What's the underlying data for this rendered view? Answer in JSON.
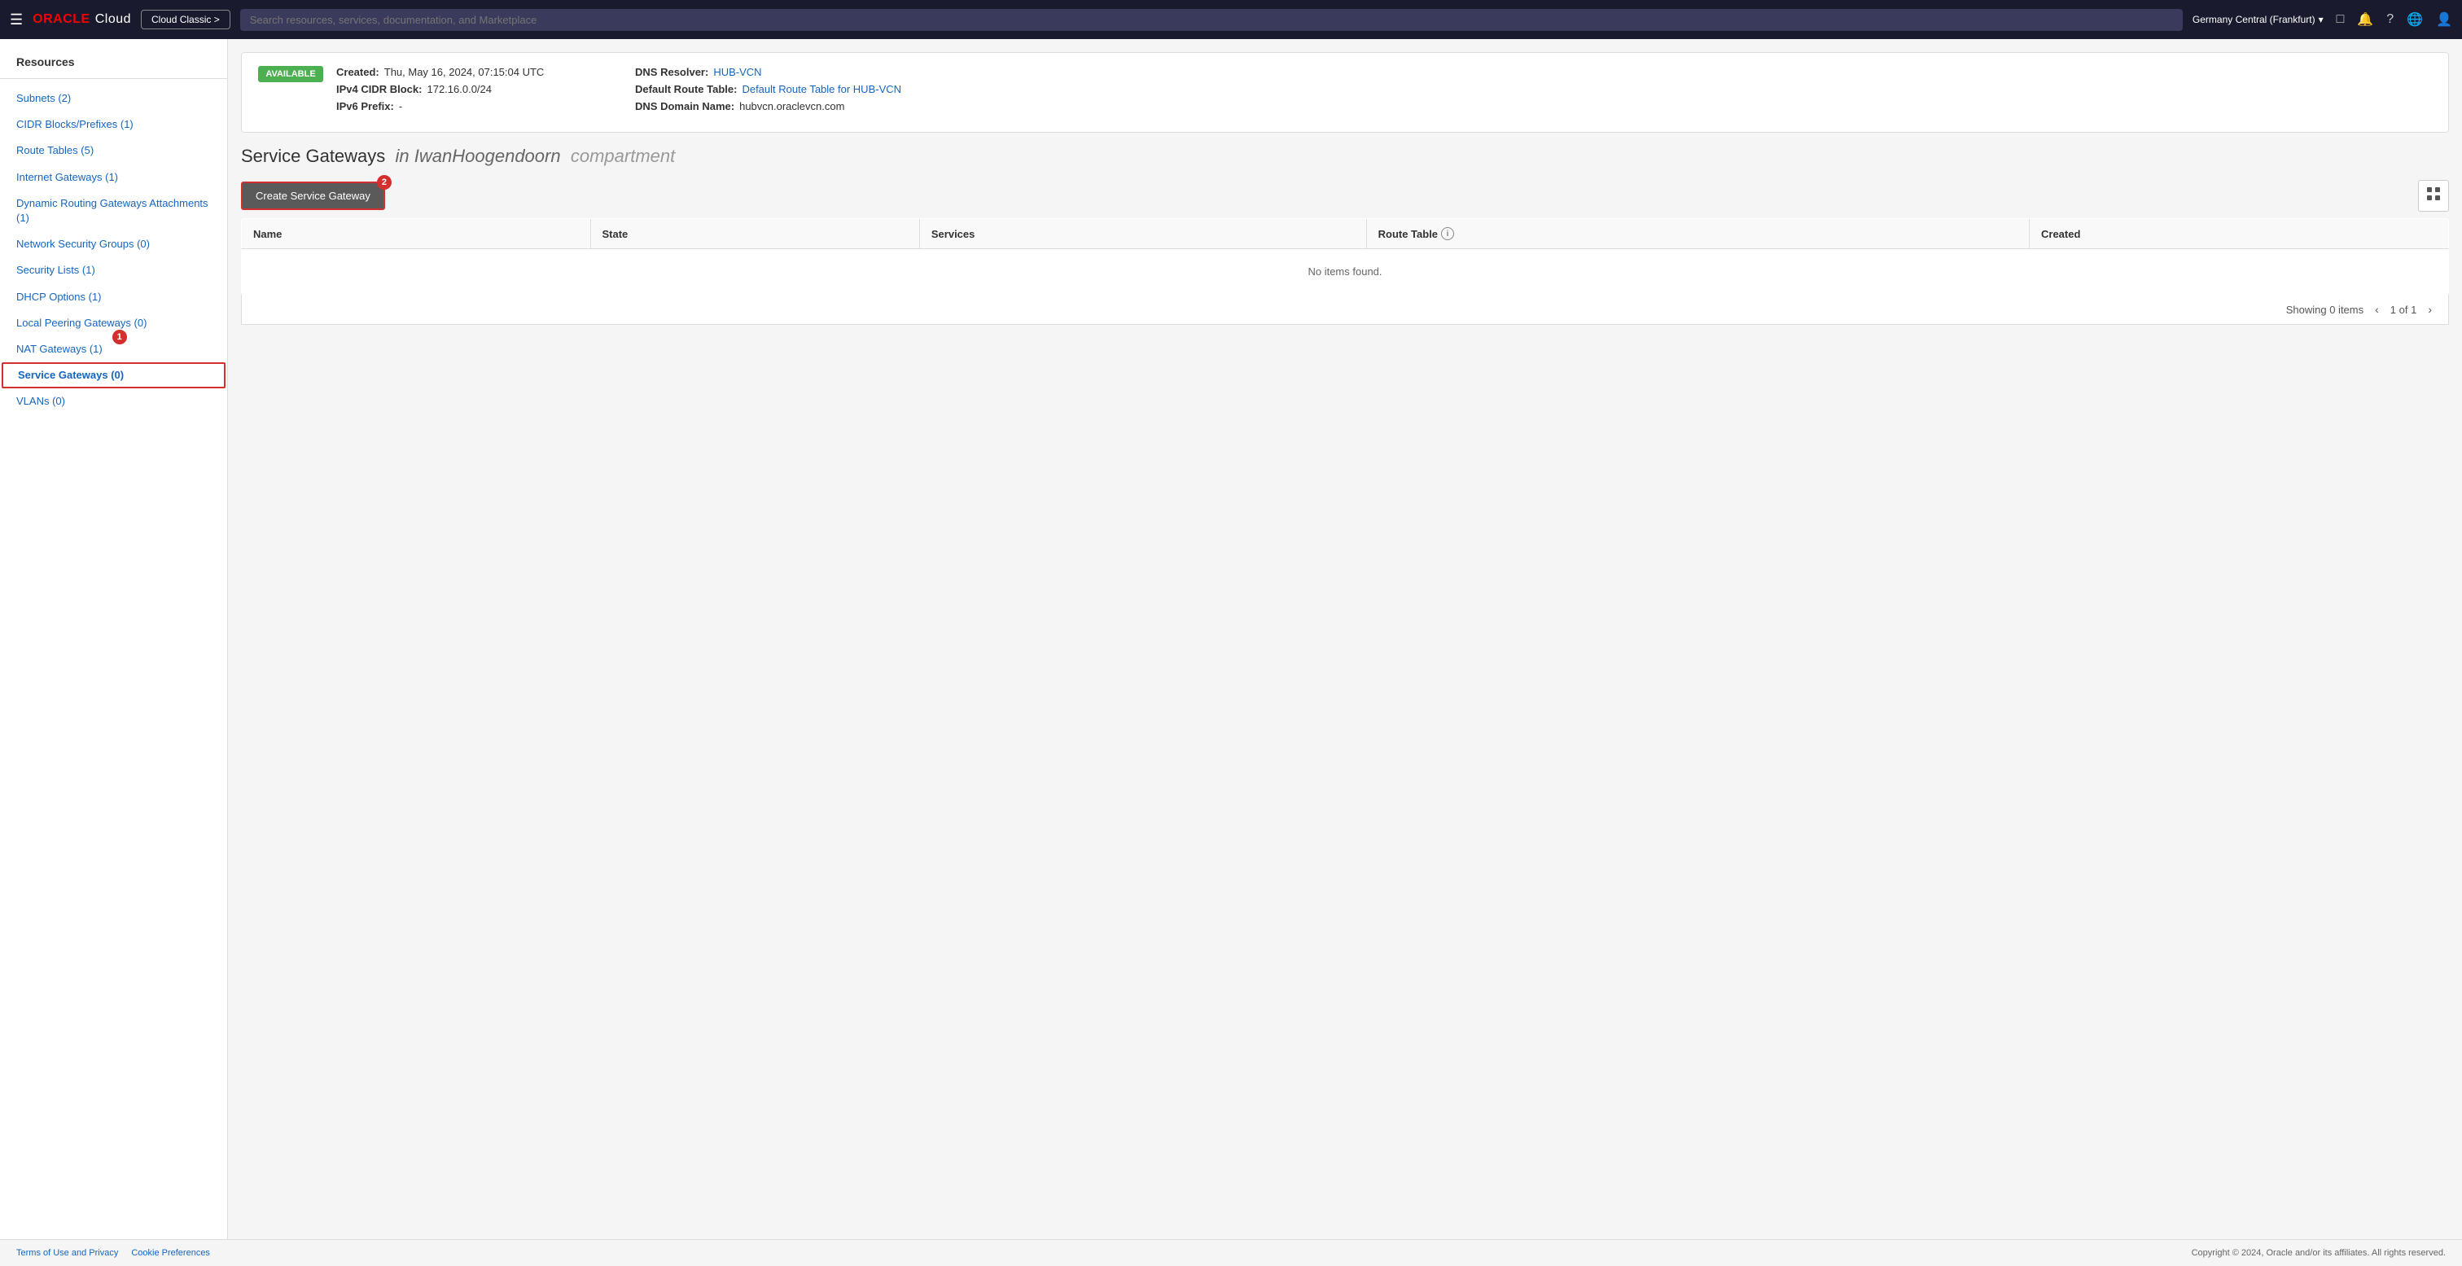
{
  "nav": {
    "hamburger": "☰",
    "logo_oracle": "ORACLE",
    "logo_cloud": "Cloud",
    "cloud_classic_btn": "Cloud Classic >",
    "search_placeholder": "Search resources, services, documentation, and Marketplace",
    "region": "Germany Central (Frankfurt)",
    "region_dropdown": "▾"
  },
  "vcn_info": {
    "status_badge": "AVAILABLE",
    "created_label": "Created:",
    "created_value": "Thu, May 16, 2024, 07:15:04 UTC",
    "ipv4_label": "IPv4 CIDR Block:",
    "ipv4_value": "172.16.0.0/24",
    "ipv6_label": "IPv6 Prefix:",
    "ipv6_value": "-",
    "dns_resolver_label": "DNS Resolver:",
    "dns_resolver_value": "HUB-VCN",
    "default_route_label": "Default Route Table:",
    "default_route_value": "Default Route Table for HUB-VCN",
    "dns_domain_label": "DNS Domain Name:",
    "dns_domain_value": "hubvcn.oraclevcn.com"
  },
  "section": {
    "title_prefix": "Service Gateways",
    "title_italic": "in IwanHoogendoorn",
    "title_compartment": "compartment"
  },
  "toolbar": {
    "create_btn_label": "Create Service Gateway",
    "create_btn_badge": "2",
    "grid_toggle_icon": "⊞"
  },
  "table": {
    "columns": [
      {
        "key": "name",
        "label": "Name"
      },
      {
        "key": "state",
        "label": "State"
      },
      {
        "key": "services",
        "label": "Services"
      },
      {
        "key": "route_table",
        "label": "Route Table",
        "has_info": true
      },
      {
        "key": "created",
        "label": "Created"
      }
    ],
    "rows": [],
    "empty_message": "No items found.",
    "footer": {
      "showing_label": "Showing 0 items",
      "pagination": "1 of 1"
    }
  },
  "sidebar": {
    "section_title": "Resources",
    "items": [
      {
        "label": "Subnets (2)",
        "active": false,
        "key": "subnets"
      },
      {
        "label": "CIDR Blocks/Prefixes (1)",
        "active": false,
        "key": "cidr"
      },
      {
        "label": "Route Tables (5)",
        "active": false,
        "key": "route-tables"
      },
      {
        "label": "Internet Gateways (1)",
        "active": false,
        "key": "internet-gateways"
      },
      {
        "label": "Dynamic Routing Gateways Attachments (1)",
        "active": false,
        "key": "drg-attachments"
      },
      {
        "label": "Network Security Groups (0)",
        "active": false,
        "key": "nsg"
      },
      {
        "label": "Security Lists (1)",
        "active": false,
        "key": "security-lists"
      },
      {
        "label": "DHCP Options (1)",
        "active": false,
        "key": "dhcp"
      },
      {
        "label": "Local Peering Gateways (0)",
        "active": false,
        "key": "lpg"
      },
      {
        "label": "NAT Gateways (1)",
        "active": false,
        "key": "nat",
        "badge": "1"
      },
      {
        "label": "Service Gateways (0)",
        "active": true,
        "key": "service-gateways"
      },
      {
        "label": "VLANs (0)",
        "active": false,
        "key": "vlans"
      }
    ]
  },
  "footer": {
    "left_links": [
      {
        "label": "Terms of Use and Privacy"
      },
      {
        "label": "Cookie Preferences"
      }
    ],
    "copyright": "Copyright © 2024, Oracle and/or its affiliates. All rights reserved."
  }
}
